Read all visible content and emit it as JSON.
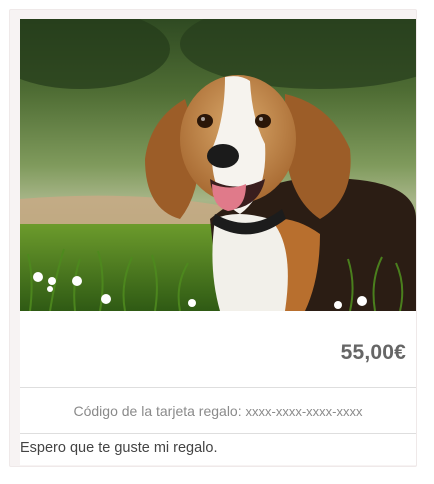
{
  "product": {
    "image_alt": "Beagle sentado en la hierba",
    "price": "55,00€"
  },
  "gift_card": {
    "code_label": "Código de la tarjeta regalo:",
    "code_value": "xxxx-xxxx-xxxx-xxxx"
  },
  "message": "Espero que te guste mi regalo.",
  "colors": {
    "frame_bg": "#f7f3f3",
    "price_text": "#666666",
    "secondary_text": "#8a8a8a",
    "body_text": "#444444"
  }
}
